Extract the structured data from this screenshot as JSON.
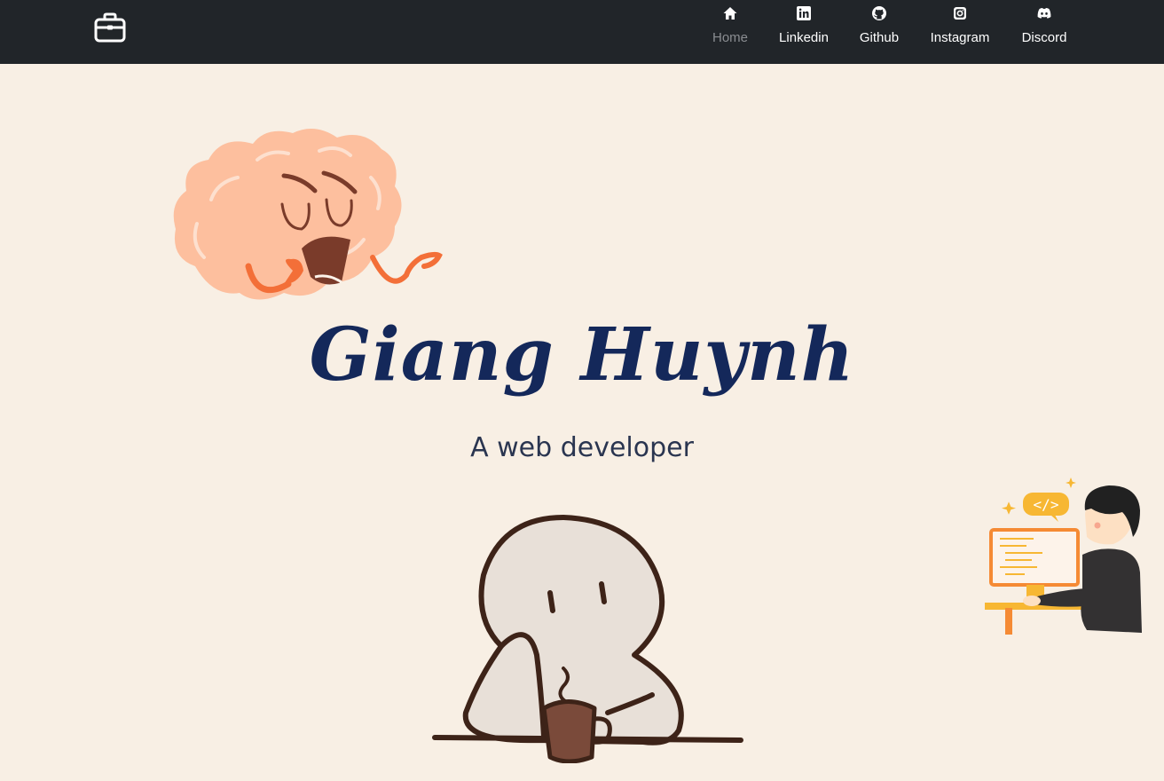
{
  "nav": {
    "brand_icon": "briefcase-icon",
    "items": [
      {
        "label": "Home",
        "icon": "home-icon",
        "active": true
      },
      {
        "label": "Linkedin",
        "icon": "linkedin-icon",
        "active": false
      },
      {
        "label": "Github",
        "icon": "github-icon",
        "active": false
      },
      {
        "label": "Instagram",
        "icon": "instagram-icon",
        "active": false
      },
      {
        "label": "Discord",
        "icon": "discord-icon",
        "active": false
      }
    ]
  },
  "hero": {
    "title": "Giang Huynh",
    "subtitle": "A web developer"
  },
  "colors": {
    "navbar": "#212529",
    "background": "#f8efe4",
    "title": "#14285a",
    "inactive_nav": "#8a8d91"
  }
}
